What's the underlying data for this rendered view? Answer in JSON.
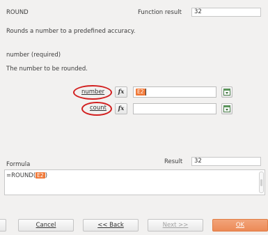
{
  "header": {
    "function_name": "ROUND",
    "function_result_label": "Function result",
    "function_result_value": "32"
  },
  "description": "Rounds a number to a predefined accuracy.",
  "argument_info": {
    "name": "number (required)",
    "description": "The number to be rounded."
  },
  "arguments": [
    {
      "label": "number",
      "fx": "fx",
      "value": "E2"
    },
    {
      "label": "count",
      "fx": "fx",
      "value": ""
    }
  ],
  "formula": {
    "label": "Formula",
    "result_label": "Result",
    "result_value": "32",
    "prefix": "=ROUND(",
    "ref": "E2",
    "suffix": ")"
  },
  "buttons": {
    "cancel": "Cancel",
    "back": "<< Back",
    "next": "Next >>",
    "ok": "OK"
  },
  "colors": {
    "highlight_ring": "#d21f1f",
    "reference_chip": "#f07a3a",
    "ok_button": "#ec8a57"
  }
}
